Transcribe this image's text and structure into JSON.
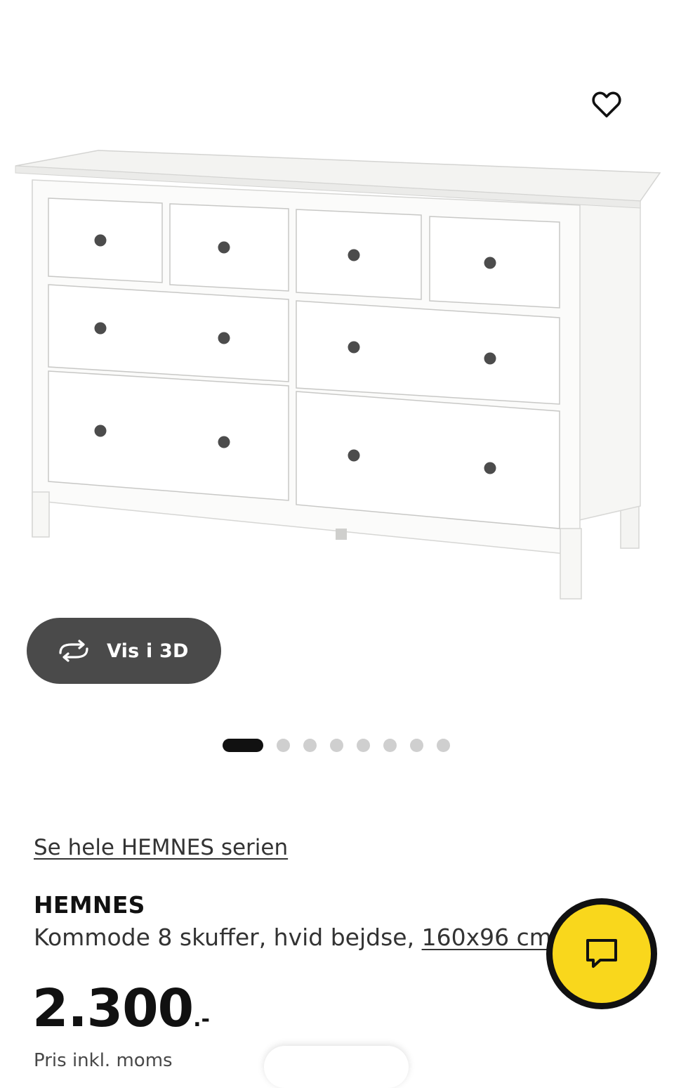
{
  "icons": {
    "wishlist": "heart-outline-icon",
    "rotate_3d": "rotate-arrows-icon",
    "chat": "chat-bubble-icon"
  },
  "gallery": {
    "image_alt": "HEMNES kommode 8 skuffer, hvid bejdse",
    "view_3d_label": "Vis i 3D",
    "dot_count": 8,
    "active_index": 0
  },
  "product": {
    "series_link": "Se hele HEMNES serien",
    "name": "HEMNES",
    "description": "Kommode 8 skuffer, hvid bejdse, ",
    "size_link": "160x96 cm",
    "price_amount": "2.300",
    "price_suffix": ".-",
    "price_note": "Pris inkl. moms"
  },
  "colors": {
    "chat_button": "#f9d71c",
    "view_3d_button": "#4a4a4a",
    "active_dot": "#111111",
    "inactive_dot": "#cfcfcf"
  }
}
